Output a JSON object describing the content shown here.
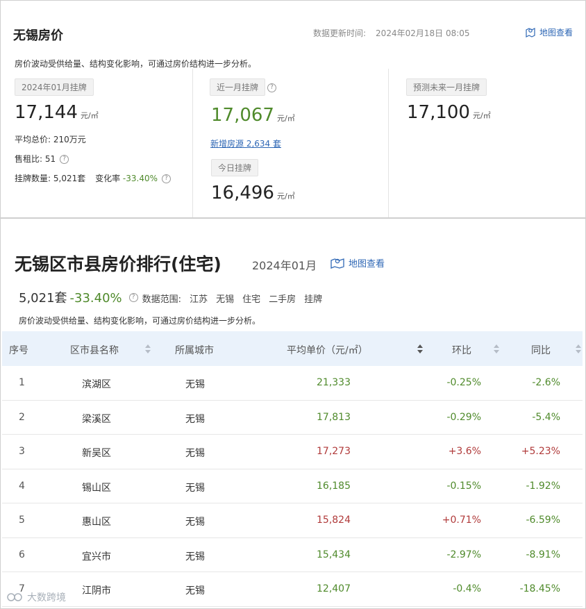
{
  "top": {
    "title": "无锡房价",
    "update_label": "数据更新时间:",
    "update_time": "2024年02月18日 08:05",
    "map_link": "地图查看",
    "description": "房价波动受供给量、结构变化影响，可通过房价结构进一步分析。",
    "col1": {
      "tag": "2024年01月挂牌",
      "price": "17,144",
      "unit": "元/㎡",
      "avg_total_label": "平均总价:",
      "avg_total_value": "210万元",
      "rent_ratio_label": "售租比:",
      "rent_ratio_value": "51",
      "listing_label": "挂牌数量:",
      "listing_value": "5,021套",
      "change_label": "变化率",
      "change_value": "-33.40%"
    },
    "col2": {
      "tag": "近一月挂牌",
      "price": "17,067",
      "unit": "元/㎡",
      "new_listings": "新增房源 2,634 套",
      "today_tag": "今日挂牌",
      "today_price": "16,496",
      "today_unit": "元/㎡"
    },
    "col3": {
      "tag": "预测未来一月挂牌",
      "price": "17,100",
      "unit": "元/㎡"
    }
  },
  "ranking": {
    "title": "无锡区市县房价排行(住宅)",
    "date": "2024年01月",
    "map_link": "地图查看",
    "count": "5,021套",
    "pct": "-33.40%",
    "range_label": "数据范围:",
    "range_items": [
      "江苏",
      "无锡",
      "住宅",
      "二手房",
      "挂牌"
    ],
    "description": "房价波动受供给量、结构变化影响，可通过房价结构进一步分析。",
    "headers": {
      "idx": "序号",
      "name": "区市县名称",
      "city": "所属城市",
      "price": "平均单价（元/㎡）",
      "mom": "环比",
      "yoy": "同比"
    },
    "rows": [
      {
        "idx": "1",
        "name": "滨湖区",
        "city": "无锡",
        "price": "21,333",
        "mom": "-0.25%",
        "yoy": "-2.6%"
      },
      {
        "idx": "2",
        "name": "梁溪区",
        "city": "无锡",
        "price": "17,813",
        "mom": "-0.29%",
        "yoy": "-5.4%"
      },
      {
        "idx": "3",
        "name": "新吴区",
        "city": "无锡",
        "price": "17,273",
        "mom": "+3.6%",
        "yoy": "+5.23%"
      },
      {
        "idx": "4",
        "name": "锡山区",
        "city": "无锡",
        "price": "16,185",
        "mom": "-0.15%",
        "yoy": "-1.92%"
      },
      {
        "idx": "5",
        "name": "惠山区",
        "city": "无锡",
        "price": "15,824",
        "mom": "+0.71%",
        "yoy": "-6.59%"
      },
      {
        "idx": "6",
        "name": "宜兴市",
        "city": "无锡",
        "price": "15,434",
        "mom": "-2.97%",
        "yoy": "-8.91%"
      },
      {
        "idx": "7",
        "name": "江阴市",
        "city": "无锡",
        "price": "12,407",
        "mom": "-0.4%",
        "yoy": "-18.45%"
      }
    ]
  },
  "watermark": "大数跨境",
  "colors": {
    "up": "#b03a3a",
    "down": "#4f8a2b",
    "link": "#2e67b5",
    "header_bg": "#eaf2fb"
  }
}
